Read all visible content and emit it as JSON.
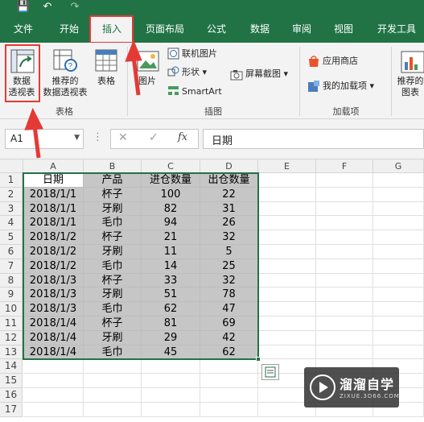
{
  "quick_access": {
    "save": "💾",
    "undo": "↶",
    "redo": "↷"
  },
  "tabs": [
    "文件",
    "开始",
    "插入",
    "页面布局",
    "公式",
    "数据",
    "审阅",
    "视图",
    "开发工具"
  ],
  "ribbon": {
    "pivot_table": [
      "数据",
      "透视表"
    ],
    "recommended_pivot": [
      "推荐的",
      "数据透视表"
    ],
    "table": "表格",
    "group_tables": "表格",
    "picture": "图片",
    "online_picture": "联机图片",
    "shapes": "形状",
    "smartart": "SmartArt",
    "screenshot": "屏幕截图",
    "group_illustrations": "插图",
    "app_store": "应用商店",
    "my_addins": "我的加载项",
    "group_addins": "加载项",
    "recommended_chart": [
      "推荐的",
      "图表"
    ]
  },
  "formula_bar": {
    "name_box": "A1",
    "fx": "fx",
    "cancel": "✕",
    "confirm": "✓",
    "content": "日期"
  },
  "sheet": {
    "columns": [
      "A",
      "B",
      "C",
      "D",
      "E",
      "F",
      "G"
    ],
    "rows": [
      "1",
      "2",
      "3",
      "4",
      "5",
      "6",
      "7",
      "8",
      "9",
      "10",
      "11",
      "12",
      "13",
      "14",
      "15",
      "16",
      "17"
    ],
    "data": [
      [
        "日期",
        "产品",
        "进仓数量",
        "出仓数量"
      ],
      [
        "2018/1/1",
        "杯子",
        "100",
        "22"
      ],
      [
        "2018/1/1",
        "牙刷",
        "82",
        "31"
      ],
      [
        "2018/1/1",
        "毛巾",
        "94",
        "26"
      ],
      [
        "2018/1/2",
        "杯子",
        "21",
        "32"
      ],
      [
        "2018/1/2",
        "牙刷",
        "11",
        "5"
      ],
      [
        "2018/1/2",
        "毛巾",
        "14",
        "25"
      ],
      [
        "2018/1/3",
        "杯子",
        "33",
        "32"
      ],
      [
        "2018/1/3",
        "牙刷",
        "51",
        "78"
      ],
      [
        "2018/1/3",
        "毛巾",
        "62",
        "47"
      ],
      [
        "2018/1/4",
        "杯子",
        "81",
        "69"
      ],
      [
        "2018/1/4",
        "牙刷",
        "29",
        "42"
      ],
      [
        "2018/1/4",
        "毛巾",
        "45",
        "62"
      ]
    ]
  },
  "watermark": {
    "title": "溜溜自学",
    "url": "ZIXUE.3D66.COM"
  },
  "colors": {
    "excel_green": "#217346",
    "highlight_red": "#e53935",
    "selection": "#c6c6c6"
  }
}
